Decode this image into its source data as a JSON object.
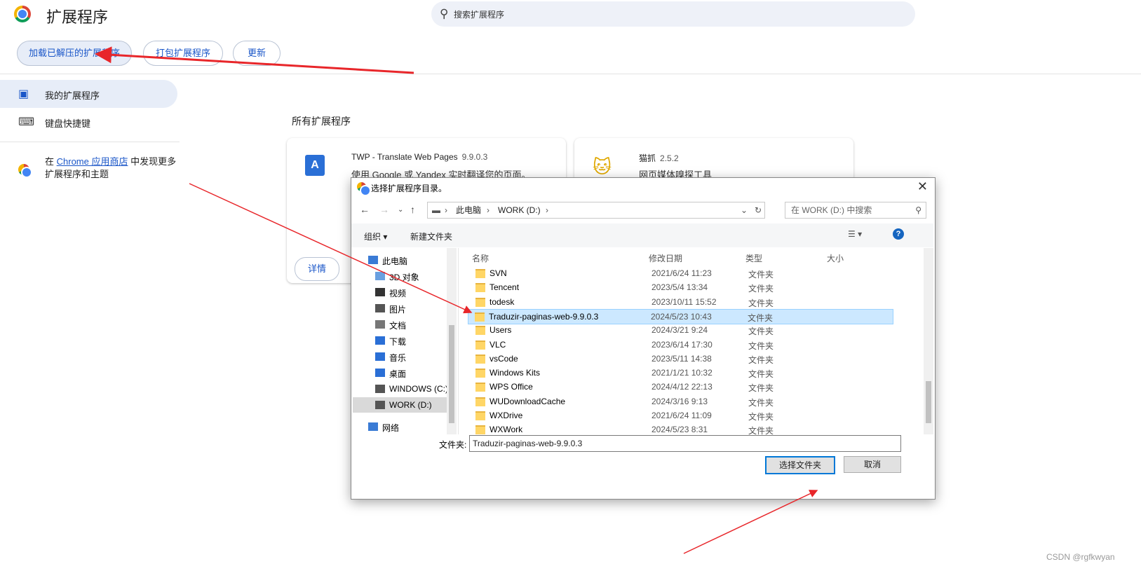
{
  "header": {
    "title": "扩展程序",
    "search_placeholder": "搜索扩展程序"
  },
  "toolbar": {
    "load_unpacked": "加载已解压的扩展程序",
    "pack": "打包扩展程序",
    "update": "更新"
  },
  "sidebar": {
    "items": [
      {
        "label": "我的扩展程序"
      },
      {
        "label": "键盘快捷键"
      }
    ],
    "store": {
      "prefix": "在 ",
      "link": "Chrome 应用商店",
      "suffix": " 中发现更多扩展程序和主题"
    }
  },
  "main": {
    "section_title": "所有扩展程序",
    "cards": [
      {
        "name": "TWP - Translate Web Pages",
        "version": "9.9.0.3",
        "desc": "使用 Google 或 Yandex 实时翻译您的页面。",
        "details": "详情"
      },
      {
        "name": "猫抓",
        "version": "2.5.2",
        "desc": "网页媒体嗅探工具"
      }
    ]
  },
  "dialog": {
    "title": "选择扩展程序目录。",
    "path": [
      "此电脑",
      "WORK (D:)"
    ],
    "search_placeholder": "在 WORK (D:) 中搜索",
    "organize": "组织",
    "new_folder": "新建文件夹",
    "help": "?",
    "nav": [
      "此电脑",
      "3D 对象",
      "视频",
      "图片",
      "文档",
      "下载",
      "音乐",
      "桌面",
      "WINDOWS (C:)",
      "WORK (D:)",
      "网络"
    ],
    "columns": [
      "名称",
      "修改日期",
      "类型",
      "大小"
    ],
    "rows": [
      {
        "name": "SVN",
        "date": "2021/6/24 11:23",
        "type": "文件夹"
      },
      {
        "name": "Tencent",
        "date": "2023/5/4 13:34",
        "type": "文件夹"
      },
      {
        "name": "todesk",
        "date": "2023/10/11 15:52",
        "type": "文件夹"
      },
      {
        "name": "Traduzir-paginas-web-9.9.0.3",
        "date": "2024/5/23 10:43",
        "type": "文件夹",
        "selected": true
      },
      {
        "name": "Users",
        "date": "2024/3/21 9:24",
        "type": "文件夹"
      },
      {
        "name": "VLC",
        "date": "2023/6/14 17:30",
        "type": "文件夹"
      },
      {
        "name": "vsCode",
        "date": "2023/5/11 14:38",
        "type": "文件夹"
      },
      {
        "name": "Windows Kits",
        "date": "2021/1/21 10:32",
        "type": "文件夹"
      },
      {
        "name": "WPS Office",
        "date": "2024/4/12 22:13",
        "type": "文件夹"
      },
      {
        "name": "WUDownloadCache",
        "date": "2024/3/16 9:13",
        "type": "文件夹"
      },
      {
        "name": "WXDrive",
        "date": "2021/6/24 11:09",
        "type": "文件夹"
      },
      {
        "name": "WXWork",
        "date": "2024/5/23 8:31",
        "type": "文件夹"
      }
    ],
    "folder_label": "文件夹:",
    "folder_value": "Traduzir-paginas-web-9.9.0.3",
    "ok": "选择文件夹",
    "cancel": "取消"
  },
  "watermark": "CSDN @rgfkwyan",
  "colors": {
    "accent": "#1a56c8",
    "annotation_arrow": "#e8262a",
    "selection": "#cce8ff"
  }
}
